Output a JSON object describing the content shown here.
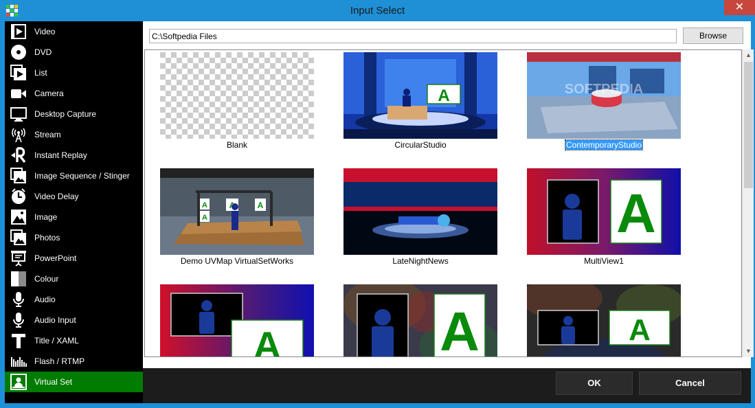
{
  "window": {
    "title": "Input Select",
    "close_label": "✕"
  },
  "sidebar": {
    "items": [
      {
        "label": "Video",
        "icon": "video-icon"
      },
      {
        "label": "DVD",
        "icon": "dvd-icon"
      },
      {
        "label": "List",
        "icon": "list-icon"
      },
      {
        "label": "Camera",
        "icon": "camera-icon"
      },
      {
        "label": "Desktop Capture",
        "icon": "desktop-icon"
      },
      {
        "label": "Stream",
        "icon": "stream-icon"
      },
      {
        "label": "Instant Replay",
        "icon": "replay-icon"
      },
      {
        "label": "Image Sequence / Stinger",
        "icon": "image-sequence-icon"
      },
      {
        "label": "Video Delay",
        "icon": "clock-icon"
      },
      {
        "label": "Image",
        "icon": "image-icon"
      },
      {
        "label": "Photos",
        "icon": "photos-icon"
      },
      {
        "label": "PowerPoint",
        "icon": "powerpoint-icon"
      },
      {
        "label": "Colour",
        "icon": "colour-icon"
      },
      {
        "label": "Audio",
        "icon": "microphone-icon"
      },
      {
        "label": "Audio Input",
        "icon": "microphone-icon"
      },
      {
        "label": "Title / XAML",
        "icon": "title-icon"
      },
      {
        "label": "Flash / RTMP",
        "icon": "flash-icon"
      },
      {
        "label": "Virtual Set",
        "icon": "virtual-set-icon",
        "active": true
      }
    ]
  },
  "path": {
    "value": "C:\\Softpedia Files"
  },
  "browse_label": "Browse",
  "tiles": [
    {
      "caption": "Blank"
    },
    {
      "caption": "CircularStudio"
    },
    {
      "caption": "ContemporaryStudio",
      "selected": true
    },
    {
      "caption": "Demo UVMap VirtualSetWorks"
    },
    {
      "caption": "LateNightNews"
    },
    {
      "caption": "MultiView1"
    },
    {
      "caption": ""
    },
    {
      "caption": ""
    },
    {
      "caption": ""
    }
  ],
  "placeholder_letter": "A",
  "watermark": "SOFTPEDIA",
  "footer": {
    "ok_label": "OK",
    "cancel_label": "Cancel"
  },
  "colors": {
    "accent": "#1f8fd6",
    "active_item": "#007c00",
    "selection": "#3399ff",
    "close": "#c7463d"
  }
}
